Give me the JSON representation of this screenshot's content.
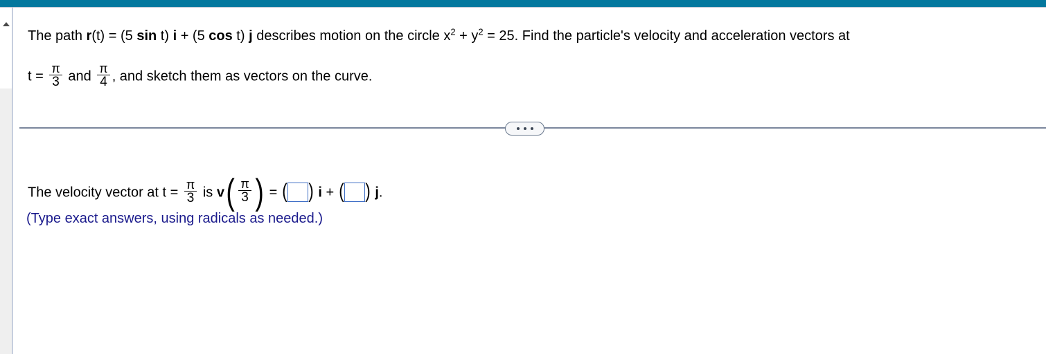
{
  "window": {
    "top_bar_color": "#04789e",
    "background_color": "#ffffff"
  },
  "scrollbar": {
    "name": "vertical-scrollbar",
    "up_arrow_glyph": "▲",
    "track_color": "#efefef"
  },
  "question": {
    "line1": {
      "seg1": "The path ",
      "r_bold": "r",
      "seg2": "(t) = (5 ",
      "sin_bold": "sin",
      "seg3": " t) ",
      "i_bold": "i",
      "seg4": " + (5 ",
      "cos_bold": "cos",
      "seg5": " t) ",
      "j_bold": "j",
      "seg6": " describes motion on the circle x",
      "x_exp": "2",
      "seg7": " + y",
      "y_exp": "2",
      "seg8": " = 25. Find the particle's velocity and acceleration vectors at"
    },
    "line2": {
      "seg1": "t = ",
      "frac1_num": "π",
      "frac1_den": "3",
      "seg2": " and ",
      "frac2_num": "π",
      "frac2_den": "4",
      "seg3": ", and sketch them as vectors on the curve."
    }
  },
  "divider": {
    "name": "section-divider",
    "menu_label": "•••",
    "line_color": "#7a869c",
    "pill_fill": "#f6f7f9",
    "pill_border": "#6b7a8f"
  },
  "answer": {
    "seg1": "The velocity vector at t = ",
    "t_frac_num": "π",
    "t_frac_den": "3",
    "seg2": " is ",
    "v_bold": "v",
    "paren_open": "(",
    "v_frac_num": "π",
    "v_frac_den": "3",
    "paren_close": ")",
    "seg3": " = ",
    "box1_paren_open": "(",
    "box1_value": "",
    "box1_paren_close": ")",
    "seg4": " ",
    "i_bold": "i",
    "seg5": " + ",
    "box2_paren_open": "(",
    "box2_value": "",
    "box2_paren_close": ")",
    "seg6": " ",
    "j_bold": "j",
    "seg7": ".",
    "instruction": "(Type exact answers, using radicals as needed.)",
    "instruction_color": "#1a1a8c",
    "input_border_color": "#3f6fc6"
  }
}
